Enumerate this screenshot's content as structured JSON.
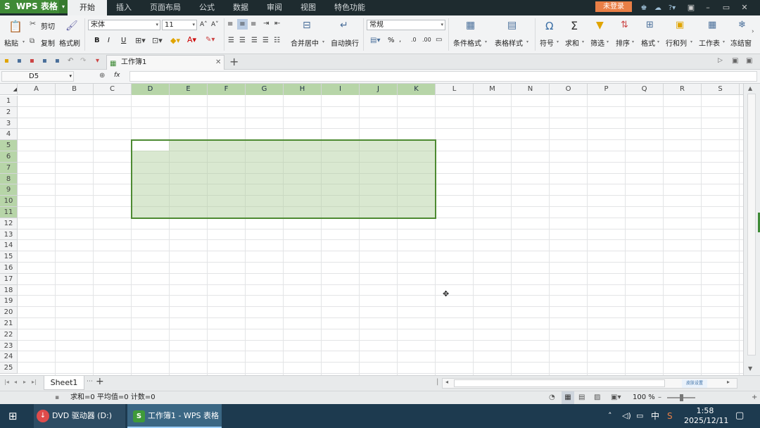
{
  "app": {
    "menu_label": "WPS 表格",
    "logo": "S",
    "login_label": "未登录"
  },
  "tabs": [
    "开始",
    "插入",
    "页面布局",
    "公式",
    "数据",
    "审阅",
    "视图",
    "特色功能"
  ],
  "ribbon": {
    "paste": "粘贴",
    "cut": "剪切",
    "copy": "复制",
    "format_painter": "格式刷",
    "font_name": "宋体",
    "font_size": "11",
    "bold": "B",
    "italic": "I",
    "underline": "U",
    "merge_center": "合并居中",
    "wrap_text": "自动换行",
    "number_format": "常规",
    "percent": "%",
    "cond_format": "条件格式",
    "table_style": "表格样式",
    "symbol": "符号",
    "sum": "求和",
    "filter": "筛选",
    "sort": "排序",
    "format": "格式",
    "rows_cols": "行和列",
    "worksheet": "工作表",
    "freeze": "冻结窗"
  },
  "document": {
    "tab_title": "工作簿1"
  },
  "formula": {
    "name_box": "D5",
    "fx": "fx",
    "content": ""
  },
  "sheet": {
    "columns": [
      "A",
      "B",
      "C",
      "D",
      "E",
      "F",
      "G",
      "H",
      "I",
      "J",
      "K",
      "L",
      "M",
      "N",
      "O",
      "P",
      "Q",
      "R",
      "S"
    ],
    "rows": [
      "1",
      "2",
      "3",
      "4",
      "5",
      "6",
      "7",
      "8",
      "9",
      "10",
      "11",
      "12",
      "13",
      "14",
      "15",
      "16",
      "17",
      "18",
      "19",
      "20",
      "21",
      "22",
      "23",
      "24",
      "25"
    ],
    "selected_columns": [
      "D",
      "E",
      "F",
      "G",
      "H",
      "I",
      "J",
      "K"
    ],
    "selected_rows": [
      "5",
      "6",
      "7",
      "8",
      "9",
      "10",
      "11"
    ],
    "selection": "D5:K11",
    "active_cell": "D5"
  },
  "sheets": {
    "tabs": [
      "Sheet1"
    ],
    "add": "+"
  },
  "status": {
    "summary": "求和=0  平均值=0  计数=0",
    "zoom": "100 %",
    "ime_settings": "皮肤设置"
  },
  "taskbar": {
    "item1": "DVD 驱动器 (D:) W...",
    "item2": "工作簿1 - WPS 表格",
    "ime": "中",
    "time": "1:58",
    "date": "2025/12/11"
  },
  "colors": {
    "accent": "#3f8a36",
    "selection_fill": "#c9ddb8",
    "selection_border": "#4d8a32",
    "login": "#e97f46"
  }
}
